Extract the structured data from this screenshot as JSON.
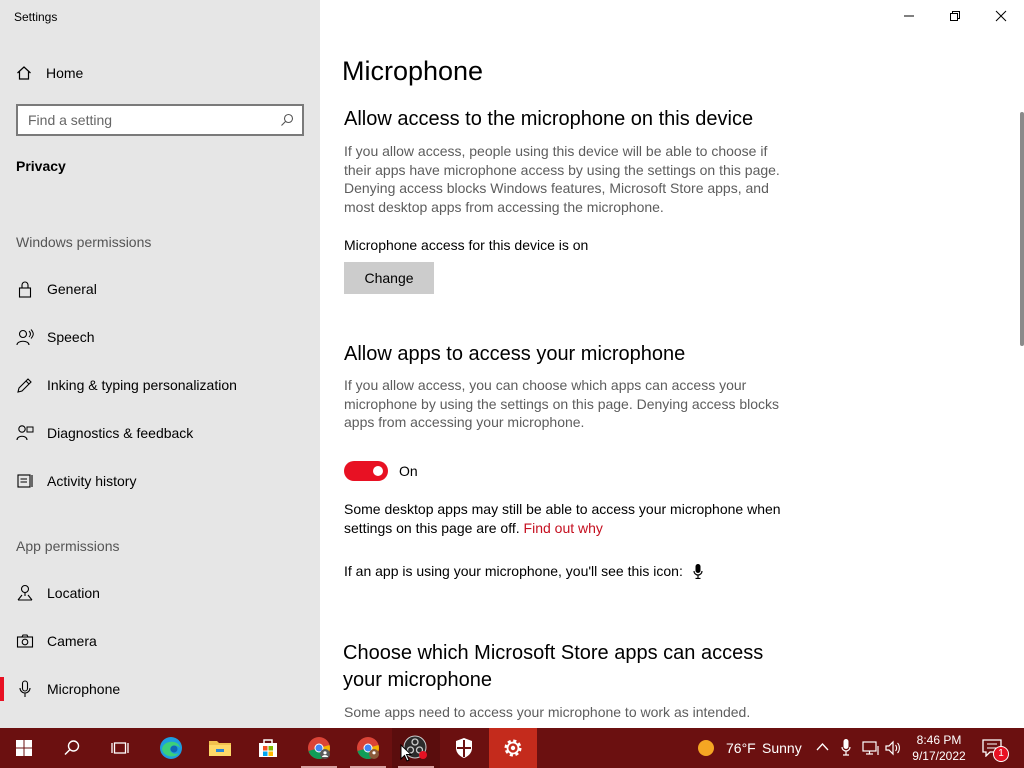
{
  "window": {
    "title": "Settings"
  },
  "sidebar": {
    "home_label": "Home",
    "search_placeholder": "Find a setting",
    "section_title": "Privacy",
    "windows_permissions_label": "Windows permissions",
    "windows_permissions": [
      {
        "label": "General",
        "icon": "lock-icon"
      },
      {
        "label": "Speech",
        "icon": "speech-icon"
      },
      {
        "label": "Inking & typing personalization",
        "icon": "inking-icon"
      },
      {
        "label": "Diagnostics & feedback",
        "icon": "diagnostics-icon"
      },
      {
        "label": "Activity history",
        "icon": "activity-history-icon"
      }
    ],
    "app_permissions_label": "App permissions",
    "app_permissions": [
      {
        "label": "Location",
        "icon": "location-icon"
      },
      {
        "label": "Camera",
        "icon": "camera-icon"
      },
      {
        "label": "Microphone",
        "icon": "microphone-icon",
        "selected": true
      }
    ]
  },
  "main": {
    "title": "Microphone",
    "device_section": {
      "heading": "Allow access to the microphone on this device",
      "description": "If you allow access, people using this device will be able to choose if their apps have microphone access by using the settings on this page. Denying access blocks Windows features, Microsoft Store apps, and most desktop apps from accessing the microphone.",
      "status": "Microphone access for this device is on",
      "change_button": "Change"
    },
    "apps_section": {
      "heading": "Allow apps to access your microphone",
      "description": "If you allow access, you can choose which apps can access your microphone by using the settings on this page. Denying access blocks apps from accessing your microphone.",
      "toggle_state": "On",
      "note": "Some desktop apps may still be able to access your microphone when settings on this page are off.",
      "note_link": "Find out why",
      "icon_note": "If an app is using your microphone, you'll see this icon:"
    },
    "store_section": {
      "heading": "Choose which Microsoft Store apps can access your microphone",
      "description": "Some apps need to access your microphone to work as intended."
    }
  },
  "taskbar": {
    "weather_temp": "76°F",
    "weather_text": "Sunny",
    "time": "8:46 PM",
    "date": "9/17/2022",
    "notification_count": "1"
  },
  "colors": {
    "accent": "#e81123",
    "link": "#c50f1f",
    "taskbar": "#6b1010",
    "sidebar_bg": "#e6e6e6"
  }
}
